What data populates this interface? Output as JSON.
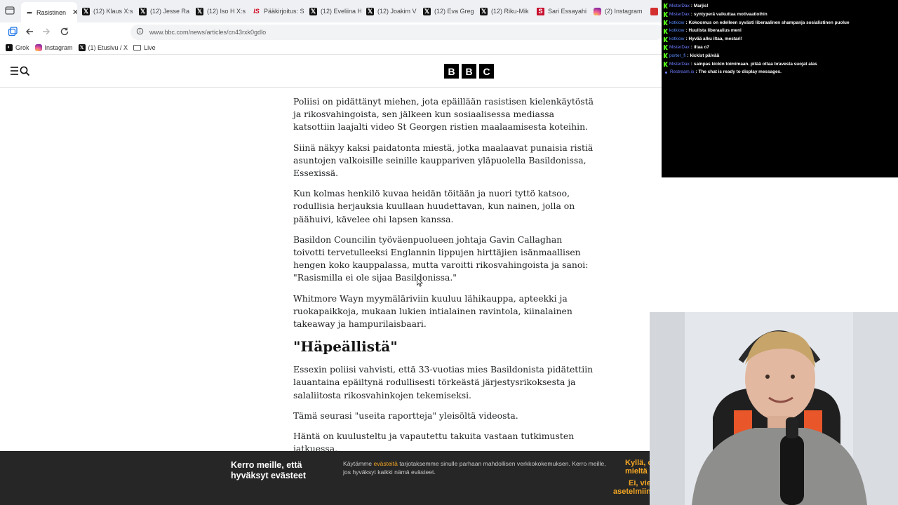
{
  "browser": {
    "tabs": [
      {
        "title": "Rasistinen",
        "icon": "dots-icon",
        "active": true
      },
      {
        "title": "(12) Klaus X:s",
        "icon": "x-icon"
      },
      {
        "title": "(12) Jesse Ra",
        "icon": "x-icon"
      },
      {
        "title": "(12) Iso H X:s",
        "icon": "x-icon"
      },
      {
        "title": "Pääkirjoitus: S",
        "icon": "is-icon"
      },
      {
        "title": "(12) Eveliina H",
        "icon": "x-icon"
      },
      {
        "title": "(12) Joakim V",
        "icon": "x-icon"
      },
      {
        "title": "(12) Eva Greg",
        "icon": "x-icon"
      },
      {
        "title": "(12) Riku-Mik",
        "icon": "x-icon"
      },
      {
        "title": "Sari Essayahi",
        "icon": "sari-icon"
      },
      {
        "title": "(2) Instagram",
        "icon": "instagram-icon"
      },
      {
        "title": "",
        "icon": "red-icon"
      }
    ],
    "tab_close": "✕",
    "address": "www.bbc.com/news/articles/cn43rxk0gdlo",
    "bookmarks": [
      {
        "label": "Grok",
        "icon": "grok-icon"
      },
      {
        "label": "Instagram",
        "icon": "instagram-icon"
      },
      {
        "label": "(1) Etusivu / X",
        "icon": "x-icon"
      },
      {
        "label": "Live",
        "icon": "folder-icon"
      }
    ]
  },
  "bbc": {
    "logo_letters": [
      "B",
      "B",
      "C"
    ]
  },
  "article": {
    "paragraphs_top": [
      "Poliisi on pidättänyt miehen, jota epäillään rasistisen kielenkäytöstä ja rikosvahingoista, sen jälkeen kun sosiaalisessa mediassa katsottiin laajalti video St Georgen ristien maalaamisesta koteihin.",
      "Siinä näkyy kaksi paidatonta miestä, jotka maalaavat punaisia ristiä asuntojen valkoisille seinille kauppariven yläpuolella Basildonissa, Essexissä.",
      "Kun kolmas henkilö kuvaa heidän töitään ja nuori tyttö katsoo, rodullisia herjauksia kuullaan huudettavan, kun nainen, jolla on päähuivi, kävelee ohi lapsen kanssa.",
      "Basildon Councilin työväenpuolueen johtaja Gavin Callaghan toivotti tervetulleeksi Englannin lippujen hirttäjien isänmaallisen hengen koko kauppalassa, mutta varoitti rikosvahingoista ja sanoi: \"Rasismilla ei ole sijaa Basildonissa.\"",
      "Whitmore Wayn myymäläriviin kuuluu lähikauppa, apteekki ja ruokapaikkoja, mukaan lukien intialainen ravintola, kiinalainen takeaway ja hampurilaisbaari."
    ],
    "heading": "\"Häpeällistä\"",
    "paragraphs_bottom": [
      "Essexin poliisi vahvisti, että 33-vuotias mies Basildonista pidätettiin lauantaina epäiltynä rodullisesti törkeästä järjestysrikoksesta ja salaliitosta rikosvahinkojen tekemiseksi.",
      "Tämä seurasi \"useita raportteja\" yleisöltä videosta.",
      "Häntä on kuulusteltu ja vapautettu takuita vastaan tutkimusten jatkuessa."
    ]
  },
  "cookie_banner": {
    "title": "Kerro meille, että hyväksyt evästeet",
    "text_before": "Käytämme ",
    "link": "evästeitä",
    "text_after": " tarjotaksemme sinulle parhaan mahdollisen verkkokokemuksen. Kerro meille, jos hyväksyt kaikki nämä evästeet.",
    "yes_line1": "Kyllä, o",
    "yes_line2": "mieltä",
    "no_line1": "Ei, vie",
    "no_line2": "asetelmiin"
  },
  "chat": {
    "messages": [
      {
        "user": "MisterDax",
        "text": "Marjis!",
        "badge": true
      },
      {
        "user": "MisterDax",
        "text": "syntyperä vaikuttaa motivaatioihin",
        "badge": true
      },
      {
        "user": "kotkiow",
        "text": "Kokoomus on edelleen syvästi liberaalinen shampanja sosialistinen puolue",
        "badge": true
      },
      {
        "user": "kotkiow",
        "text": "Huulista liberaalius meni",
        "badge": true
      },
      {
        "user": "kotkiow",
        "text": "Hyvää alku iltaa, mestari!",
        "badge": true
      },
      {
        "user": "MisterDax",
        "text": "iltaa o7",
        "badge": true
      },
      {
        "user": "porter_fi",
        "text": "kickist päivää",
        "badge": true
      },
      {
        "user": "MisterDax",
        "text": "sainpas kickin toimimaan. pitää ottaa bravesta suojat alas",
        "badge": true
      },
      {
        "user": "Restream.io",
        "text": "The chat is ready to display messages.",
        "badge": false
      }
    ]
  },
  "colors": {
    "cookie_bg": "#262626",
    "cookie_accent": "#f5a623",
    "chat_bg": "#000000",
    "kick_green": "#53fc18"
  }
}
